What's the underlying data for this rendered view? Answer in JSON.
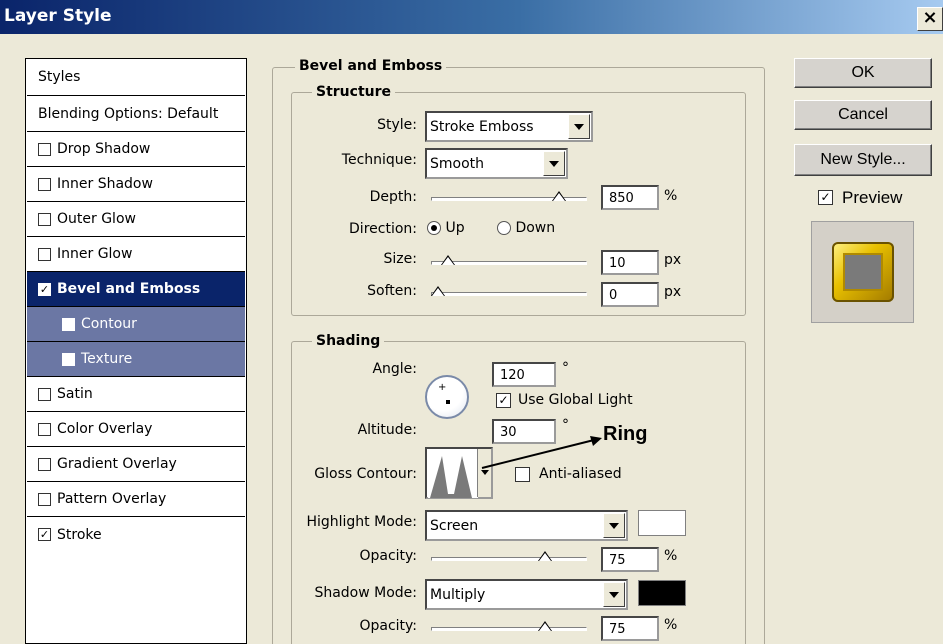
{
  "window": {
    "title": "Layer Style",
    "close": "×"
  },
  "sidebar": {
    "items": [
      {
        "label": "Styles"
      },
      {
        "label": "Blending Options: Default"
      },
      {
        "label": "Drop Shadow",
        "checked": ""
      },
      {
        "label": "Inner Shadow",
        "checked": ""
      },
      {
        "label": "Outer Glow",
        "checked": ""
      },
      {
        "label": "Inner Glow",
        "checked": ""
      },
      {
        "label": "Bevel and Emboss",
        "checked": "✓"
      },
      {
        "label": "Contour",
        "checked": ""
      },
      {
        "label": "Texture",
        "checked": ""
      },
      {
        "label": "Satin",
        "checked": ""
      },
      {
        "label": "Color Overlay",
        "checked": ""
      },
      {
        "label": "Gradient Overlay",
        "checked": ""
      },
      {
        "label": "Pattern Overlay",
        "checked": ""
      },
      {
        "label": "Stroke",
        "checked": "✓"
      }
    ]
  },
  "bevel": {
    "title": "Bevel and Emboss",
    "structure": {
      "title": "Structure",
      "style_label": "Style:",
      "style_value": "Stroke Emboss",
      "technique_label": "Technique:",
      "technique_value": "Smooth",
      "depth_label": "Depth:",
      "depth_value": "850",
      "depth_unit": "%",
      "depth_level": 0.85,
      "direction_label": "Direction:",
      "up_label": "Up",
      "down_label": "Down",
      "size_label": "Size:",
      "size_value": "10",
      "size_unit": "px",
      "size_level": 0.07,
      "soften_label": "Soften:",
      "soften_value": "0",
      "soften_unit": "px",
      "soften_level": 0.0
    },
    "shading": {
      "title": "Shading",
      "angle_label": "Angle:",
      "angle_value": "120",
      "angle_unit": "°",
      "global_light_label": "Use Global Light",
      "global_light_checked": "✓",
      "altitude_label": "Altitude:",
      "altitude_value": "30",
      "altitude_unit": "°",
      "annotation": "Ring",
      "gloss_label": "Gloss Contour:",
      "anti_aliased_label": "Anti-aliased",
      "anti_aliased_checked": "",
      "highlight_mode_label": "Highlight Mode:",
      "highlight_mode_value": "Screen",
      "highlight_color": "#ffffff",
      "opacity1_label": "Opacity:",
      "opacity1_value": "75",
      "opacity1_unit": "%",
      "opacity1_level": 0.75,
      "shadow_mode_label": "Shadow Mode:",
      "shadow_mode_value": "Multiply",
      "shadow_color": "#000000",
      "opacity2_label": "Opacity:",
      "opacity2_value": "75",
      "opacity2_unit": "%",
      "opacity2_level": 0.75
    }
  },
  "buttons": {
    "ok": "OK",
    "cancel": "Cancel",
    "new_style": "New Style..."
  },
  "preview": {
    "label": "Preview",
    "checked": "✓"
  }
}
